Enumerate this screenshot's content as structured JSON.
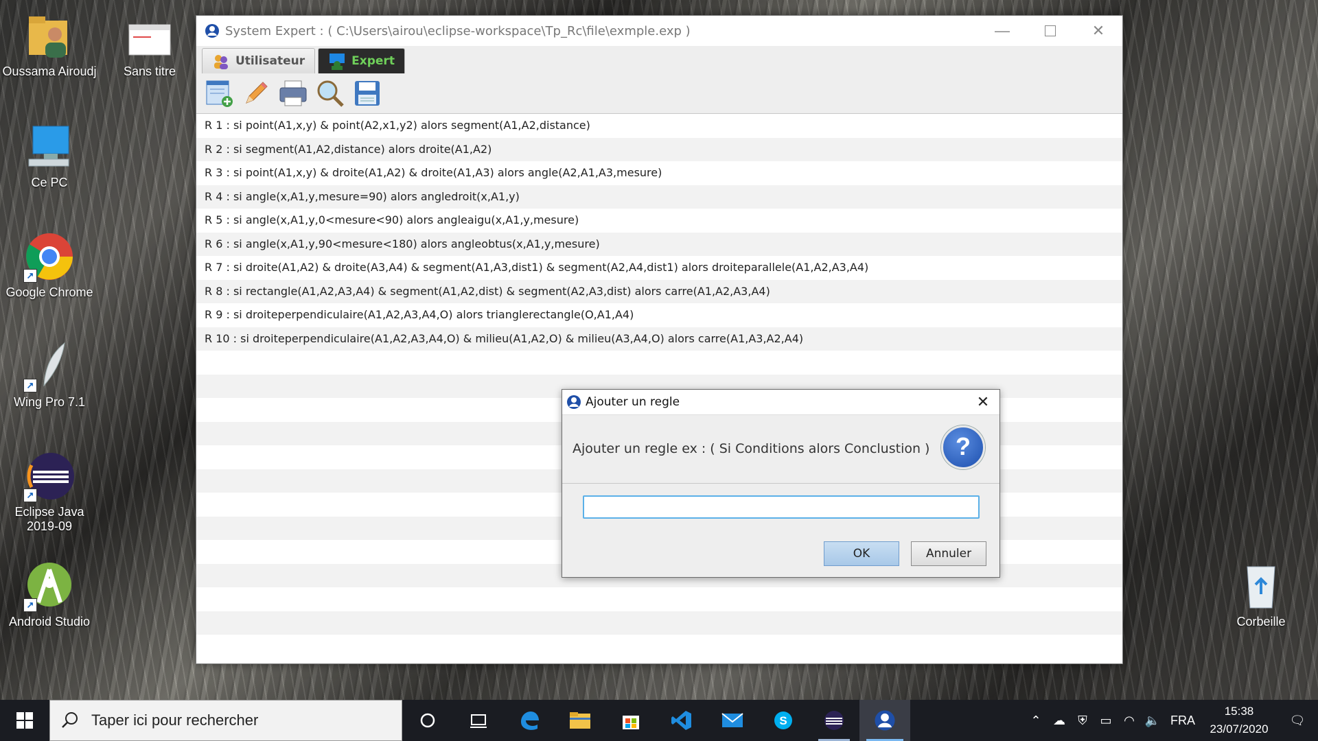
{
  "desktop": {
    "icons": [
      {
        "label": "Oussama Airoudj"
      },
      {
        "label": "Sans titre"
      },
      {
        "label": "Ce PC"
      },
      {
        "label": "Google Chrome"
      },
      {
        "label": "Wing Pro 7.1"
      },
      {
        "label": "Eclipse Java 2019-09"
      },
      {
        "label": "Android Studio"
      },
      {
        "label": "Corbeille"
      }
    ]
  },
  "window": {
    "title": "System Expert : ( C:\\Users\\airou\\eclipse-workspace\\Tp_Rc\\file\\exmple.exp )",
    "tabs": [
      {
        "label": "Utilisateur"
      },
      {
        "label": "Expert"
      }
    ],
    "toolbar": [
      "add-rule-icon",
      "edit-pencil-icon",
      "printer-icon",
      "search-icon",
      "save-floppy-icon"
    ],
    "rules": [
      "R 1 : si point(A1,x,y) & point(A2,x1,y2) alors segment(A1,A2,distance)",
      "R 2 : si segment(A1,A2,distance) alors droite(A1,A2)",
      "R 3 : si point(A1,x,y) & droite(A1,A2) & droite(A1,A3) alors angle(A2,A1,A3,mesure)",
      "R 4 : si angle(x,A1,y,mesure=90) alors angledroit(x,A1,y)",
      "R 5 : si angle(x,A1,y,0<mesure<90) alors angleaigu(x,A1,y,mesure)",
      "R 6 : si angle(x,A1,y,90<mesure<180) alors angleobtus(x,A1,y,mesure)",
      "R 7 : si droite(A1,A2) & droite(A3,A4) & segment(A1,A3,dist1) & segment(A2,A4,dist1) alors droiteparallele(A1,A2,A3,A4)",
      "R 8 : si rectangle(A1,A2,A3,A4) & segment(A1,A2,dist) & segment(A2,A3,dist) alors carre(A1,A2,A3,A4)",
      "R 9 : si droiteperpendiculaire(A1,A2,A3,A4,O) alors trianglerectangle(O,A1,A4)",
      "R 10 : si droiteperpendiculaire(A1,A2,A3,A4,O) & milieu(A1,A2,O) & milieu(A3,A4,O) alors carre(A1,A3,A2,A4)"
    ]
  },
  "dialog": {
    "title": "Ajouter un regle",
    "message": "Ajouter un regle ex : ( Si Conditions alors Conclustion )",
    "input_value": "",
    "ok_label": "OK",
    "cancel_label": "Annuler"
  },
  "taskbar": {
    "search_placeholder": "Taper ici pour rechercher",
    "language": "FRA",
    "time": "15:38",
    "date": "23/07/2020"
  }
}
